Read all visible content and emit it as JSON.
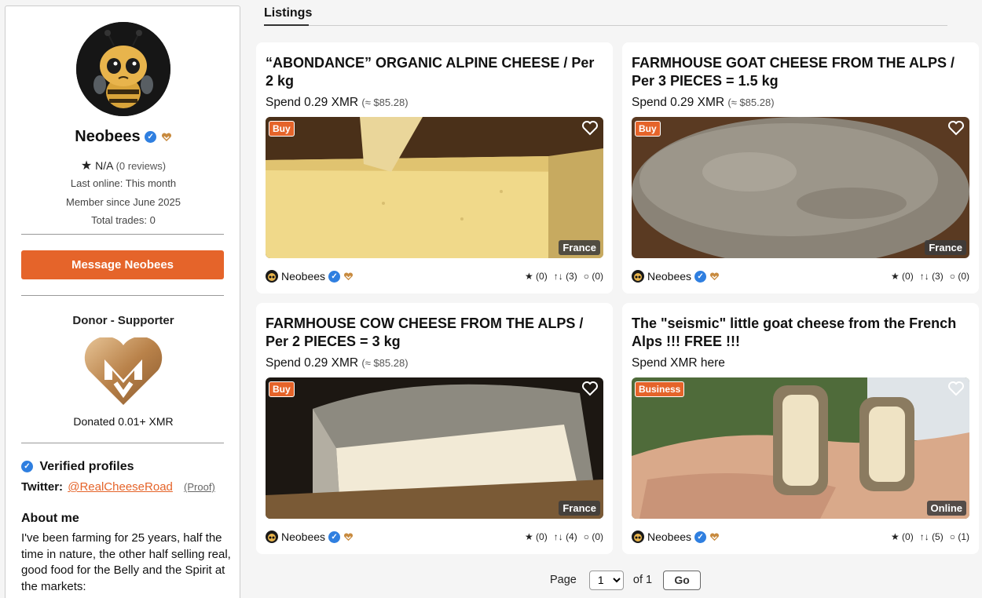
{
  "profile": {
    "name": "Neobees",
    "rating": "N/A",
    "reviews": "(0 reviews)",
    "last_online": "Last online: This month",
    "member_since": "Member since June 2025",
    "total_trades": "Total trades: 0",
    "message_button": "Message Neobees",
    "donor_title": "Donor - Supporter",
    "donated": "Donated 0.01+ XMR",
    "verified_heading": "Verified profiles",
    "twitter_label": "Twitter:",
    "twitter_handle": "@RealCheeseRoad",
    "proof_label": "(Proof)",
    "about_heading": "About me",
    "about_text": "I've been farming for 25 years, half the time in nature, the other half selling real, good food for the Belly and the Spirit at the markets:"
  },
  "tabs": {
    "active": "Listings"
  },
  "listings": [
    {
      "title": "“ABONDANCE” ORGANIC ALPINE CHEESE / Per 2 kg",
      "price": "Spend 0.29 XMR",
      "approx": "(≈ $85.28)",
      "tag": "Buy",
      "location": "France",
      "seller": "Neobees",
      "stars": "(0)",
      "trades": "(3)",
      "comments": "(0)"
    },
    {
      "title": "FARMHOUSE GOAT CHEESE FROM THE ALPS / Per 3 PIECES = 1.5 kg",
      "price": "Spend 0.29 XMR",
      "approx": "(≈ $85.28)",
      "tag": "Buy",
      "location": "France",
      "seller": "Neobees",
      "stars": "(0)",
      "trades": "(3)",
      "comments": "(0)"
    },
    {
      "title": "FARMHOUSE COW CHEESE FROM THE ALPS / Per 2 PIECES = 3 kg",
      "price": "Spend 0.29 XMR",
      "approx": "(≈ $85.28)",
      "tag": "Buy",
      "location": "France",
      "seller": "Neobees",
      "stars": "(0)",
      "trades": "(4)",
      "comments": "(0)"
    },
    {
      "title": "The \"seismic\" little goat cheese from the French Alps !!! FREE !!!",
      "price": "Spend XMR here",
      "approx": "",
      "tag": "Business",
      "location": "Online",
      "seller": "Neobees",
      "stars": "(0)",
      "trades": "(5)",
      "comments": "(1)"
    }
  ],
  "pagination": {
    "page_label": "Page",
    "current_page": "1",
    "of_label": "of 1",
    "go_label": "Go"
  },
  "colors": {
    "accent": "#e5642a",
    "verified": "#2f7fe0"
  }
}
